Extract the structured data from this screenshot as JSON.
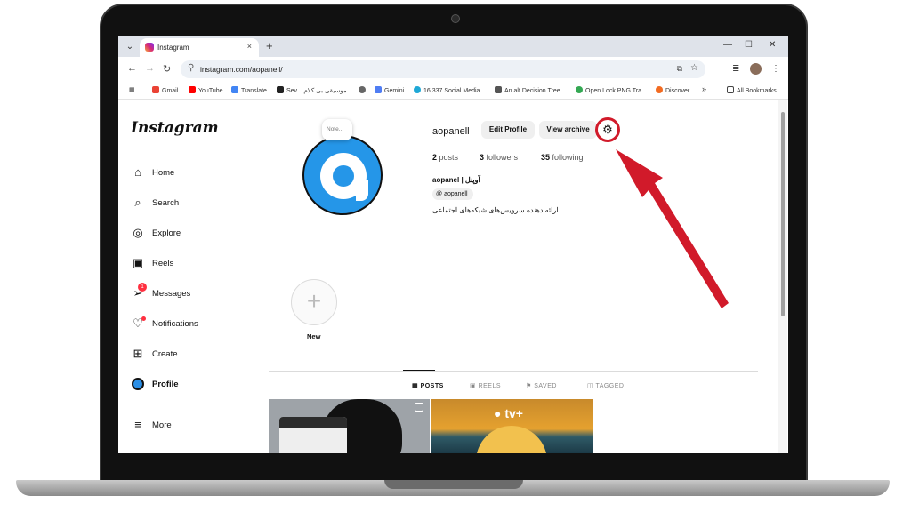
{
  "browser": {
    "tab_title": "Instagram",
    "tab_close": "×",
    "new_tab": "+",
    "url": "instagram.com/aopanell/",
    "window_controls": [
      "—",
      "☐",
      "✕"
    ],
    "bookmarks": [
      {
        "label": "Gmail",
        "color": "#ea4335"
      },
      {
        "label": "YouTube",
        "color": "#ff0000"
      },
      {
        "label": "Translate",
        "color": "#4285f4"
      },
      {
        "label": "Sev... موسیقی بی کلام",
        "color": "#222222"
      },
      {
        "label": "",
        "color": "#666666"
      },
      {
        "label": "Gemini",
        "color": "#4f7df3"
      },
      {
        "label": "16,337 Social Media...",
        "color": "#1fa8d6"
      },
      {
        "label": "An alt Decision Tree...",
        "color": "#555555"
      },
      {
        "label": "Open Lock PNG Tra...",
        "color": "#34a853"
      },
      {
        "label": "Discover",
        "color": "#f26b21"
      }
    ],
    "more_bookmarks": "»",
    "all_bookmarks": "All Bookmarks"
  },
  "instagram": {
    "logo": "Instagram",
    "nav": [
      {
        "label": "Home",
        "icon": "⌂"
      },
      {
        "label": "Search",
        "icon": "⌕"
      },
      {
        "label": "Explore",
        "icon": "◎"
      },
      {
        "label": "Reels",
        "icon": "▣"
      },
      {
        "label": "Messages",
        "icon": "➢"
      },
      {
        "label": "Notifications",
        "icon": "♡"
      },
      {
        "label": "Create",
        "icon": "⊞"
      },
      {
        "label": "Profile",
        "icon": ""
      },
      {
        "label": "More",
        "icon": "≡"
      }
    ],
    "messages_badge": "1",
    "note": "Note...",
    "username": "aopanell",
    "edit_profile": "Edit Profile",
    "view_archive": "View archive",
    "stats": {
      "posts_count": "2",
      "posts_label": "posts",
      "followers_count": "3",
      "followers_label": "followers",
      "following_count": "35",
      "following_label": "following"
    },
    "full_name": "aopanel | آوپنل",
    "threads_handle": "aopanell",
    "bio": "ارائه دهنده سرویس‌های شبکه‌های اجتماعی",
    "highlight_new": "New",
    "tabs": [
      "POSTS",
      "REELS",
      "SAVED",
      "TAGGED"
    ],
    "post2_label": "tv+"
  },
  "colors": {
    "annotation_red": "#d11a2a",
    "avatar_blue": "#2596e8",
    "badge_red": "#ff3040"
  }
}
